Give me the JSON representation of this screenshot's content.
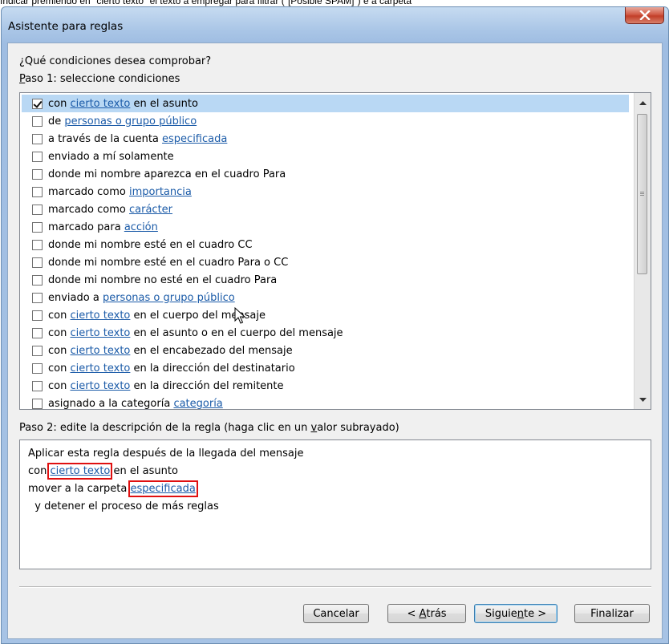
{
  "caption": "Indicar premiendo en \"cierto texto\" el texto a empregar para filtrar (\"[Posible SPAM]\") e a carpeta",
  "window": {
    "title": "Asistente para reglas"
  },
  "step_header": {
    "question": "¿Qué condiciones desea comprobar?",
    "step1_prefix": "P",
    "step1_rest": "aso 1: seleccione condiciones"
  },
  "conditions": [
    {
      "checked": true,
      "parts": [
        {
          "t": "con "
        },
        {
          "t": "cierto texto",
          "link": true
        },
        {
          "t": " en el asunto"
        }
      ]
    },
    {
      "checked": false,
      "parts": [
        {
          "t": "de "
        },
        {
          "t": "personas o grupo público",
          "link": true
        }
      ]
    },
    {
      "checked": false,
      "parts": [
        {
          "t": "a través de la cuenta "
        },
        {
          "t": "especificada",
          "link": true
        }
      ]
    },
    {
      "checked": false,
      "parts": [
        {
          "t": "enviado a mí solamente"
        }
      ]
    },
    {
      "checked": false,
      "parts": [
        {
          "t": "donde mi nombre aparezca en el cuadro Para"
        }
      ]
    },
    {
      "checked": false,
      "parts": [
        {
          "t": "marcado como "
        },
        {
          "t": "importancia",
          "link": true
        }
      ]
    },
    {
      "checked": false,
      "parts": [
        {
          "t": "marcado como "
        },
        {
          "t": "carácter",
          "link": true
        }
      ]
    },
    {
      "checked": false,
      "parts": [
        {
          "t": "marcado para "
        },
        {
          "t": "acción",
          "link": true
        }
      ]
    },
    {
      "checked": false,
      "parts": [
        {
          "t": "donde mi nombre esté en el cuadro CC"
        }
      ]
    },
    {
      "checked": false,
      "parts": [
        {
          "t": "donde mi nombre esté en el cuadro Para o CC"
        }
      ]
    },
    {
      "checked": false,
      "parts": [
        {
          "t": "donde mi nombre no esté en el cuadro Para"
        }
      ]
    },
    {
      "checked": false,
      "parts": [
        {
          "t": "enviado a "
        },
        {
          "t": "personas o grupo público",
          "link": true
        }
      ]
    },
    {
      "checked": false,
      "parts": [
        {
          "t": "con "
        },
        {
          "t": "cierto texto",
          "link": true
        },
        {
          "t": " en el cuerpo del mensaje"
        }
      ]
    },
    {
      "checked": false,
      "parts": [
        {
          "t": "con "
        },
        {
          "t": "cierto texto",
          "link": true
        },
        {
          "t": " en el asunto o en el cuerpo del mensaje"
        }
      ]
    },
    {
      "checked": false,
      "parts": [
        {
          "t": "con "
        },
        {
          "t": "cierto texto",
          "link": true
        },
        {
          "t": " en el encabezado del mensaje"
        }
      ]
    },
    {
      "checked": false,
      "parts": [
        {
          "t": "con "
        },
        {
          "t": "cierto texto",
          "link": true
        },
        {
          "t": " en la dirección del destinatario"
        }
      ]
    },
    {
      "checked": false,
      "parts": [
        {
          "t": "con "
        },
        {
          "t": "cierto texto",
          "link": true
        },
        {
          "t": " en la dirección del remitente"
        }
      ]
    },
    {
      "checked": false,
      "parts": [
        {
          "t": "asignado a la categoría "
        },
        {
          "t": "categoría",
          "link": true
        }
      ]
    }
  ],
  "step2": {
    "prefix": "Paso 2: edite la descripción de la regla (haga clic en un ",
    "underlined": "v",
    "suffix": "alor subrayado)"
  },
  "description": {
    "line1": "Aplicar esta regla después de la llegada del mensaje",
    "line2_prefix": "con ",
    "line2_link": "cierto texto",
    "line2_suffix": " en el asunto",
    "line3_prefix": "mover a la carpeta ",
    "line3_link": "especificada",
    "line4": "  y detener el proceso de más reglas"
  },
  "buttons": {
    "cancel": "Cancelar",
    "back_prefix": "< ",
    "back_underlined": "A",
    "back_suffix": "trás",
    "next_prefix": "Siguie",
    "next_underlined": "n",
    "next_suffix": "te >",
    "finish": "Finalizar"
  }
}
